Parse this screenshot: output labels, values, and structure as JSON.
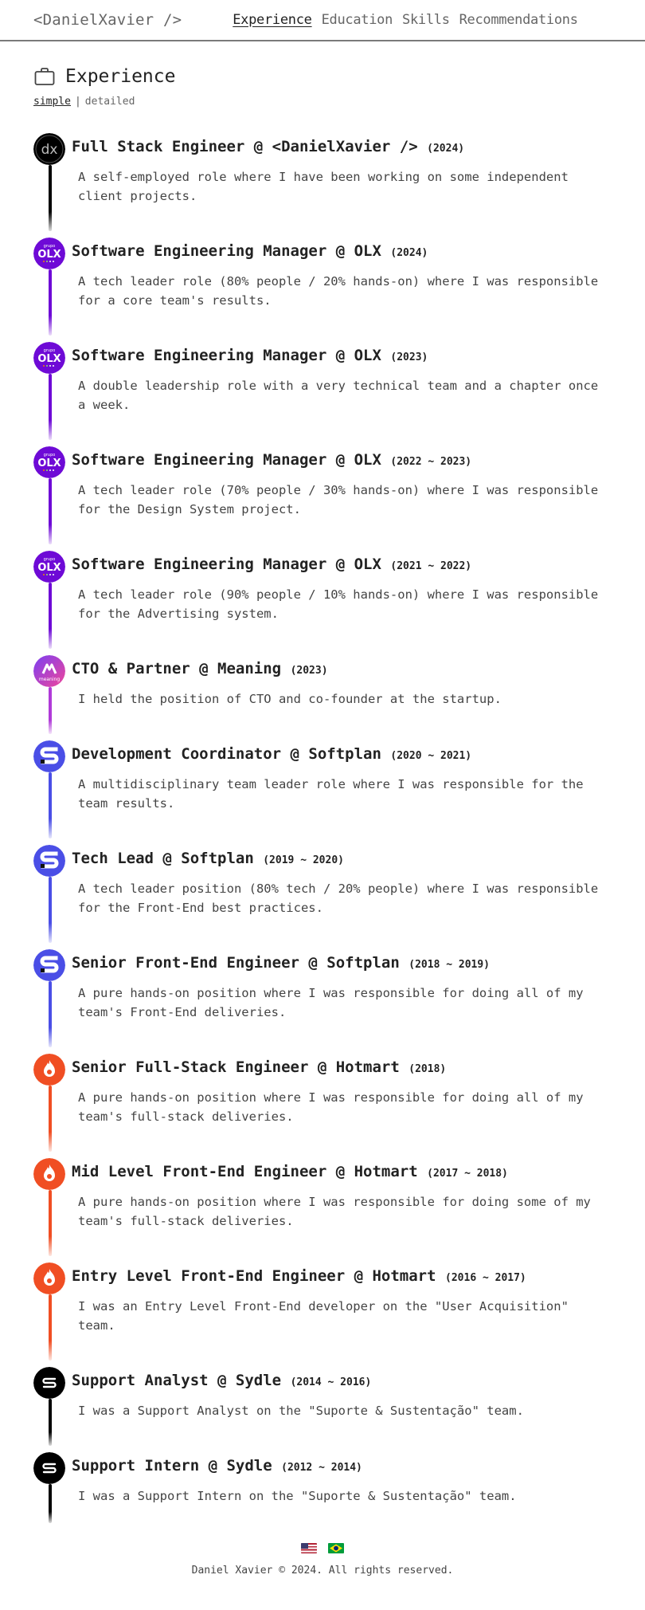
{
  "header": {
    "brand": "<DanielXavier />",
    "nav": [
      "Experience",
      "Education",
      "Skills",
      "Recommendations"
    ],
    "active_nav": "Experience"
  },
  "section": {
    "title": "Experience",
    "icon": "briefcase-icon",
    "modes": [
      "simple",
      "detailed"
    ],
    "active_mode": "simple"
  },
  "experiences": [
    {
      "role": "Full Stack Engineer @ <DanielXavier />",
      "period": "(2024)",
      "desc": "A self-employed role where I have been working on some independent client projects.",
      "logo": "dx",
      "color": "#000000"
    },
    {
      "role": "Software Engineering Manager @ OLX",
      "period": "(2024)",
      "desc": "A tech leader role (80% people / 20% hands-on) where I was responsible for a core team's results.",
      "logo": "olx",
      "color": "#6e0ad6"
    },
    {
      "role": "Software Engineering Manager @ OLX",
      "period": "(2023)",
      "desc": "A double leadership role with a very technical team and a chapter once a week.",
      "logo": "olx",
      "color": "#6e0ad6"
    },
    {
      "role": "Software Engineering Manager @ OLX",
      "period": "(2022 ~ 2023)",
      "desc": "A tech leader role (70% people / 30% hands-on) where I was responsible for the Design System project.",
      "logo": "olx",
      "color": "#6e0ad6"
    },
    {
      "role": "Software Engineering Manager @ OLX",
      "period": "(2021 ~ 2022)",
      "desc": "A tech leader role (90% people / 10% hands-on) where I was responsible for the Advertising system.",
      "logo": "olx",
      "color": "#6e0ad6"
    },
    {
      "role": "CTO & Partner @ Meaning",
      "period": "(2023)",
      "desc": "I held the position of CTO and co-founder at the startup.",
      "logo": "meaning",
      "color": "#b03ad8"
    },
    {
      "role": "Development Coordinator @ Softplan",
      "period": "(2020 ~ 2021)",
      "desc": "A multidisciplinary team leader role where I was responsible for the team results.",
      "logo": "softplan",
      "color": "#4a4ee6"
    },
    {
      "role": "Tech Lead @ Softplan",
      "period": "(2019 ~ 2020)",
      "desc": "A tech leader position (80% tech / 20% people) where I was responsible for the Front-End best practices.",
      "logo": "softplan",
      "color": "#4a4ee6"
    },
    {
      "role": "Senior Front-End Engineer @ Softplan",
      "period": "(2018 ~ 2019)",
      "desc": "A pure hands-on position where I was responsible for doing all of my team's Front-End deliveries.",
      "logo": "softplan",
      "color": "#4a4ee6"
    },
    {
      "role": "Senior Full-Stack Engineer @ Hotmart",
      "period": "(2018)",
      "desc": "A pure hands-on position where I was responsible for doing all of my team's full-stack deliveries.",
      "logo": "hotmart",
      "color": "#f04e23"
    },
    {
      "role": "Mid Level Front-End Engineer @ Hotmart",
      "period": "(2017 ~ 2018)",
      "desc": "A pure hands-on position where I was responsible for doing some of my team's full-stack deliveries.",
      "logo": "hotmart",
      "color": "#f04e23"
    },
    {
      "role": "Entry Level Front-End Engineer @ Hotmart",
      "period": "(2016 ~ 2017)",
      "desc": "I was an Entry Level Front-End developer on the \"User Acquisition\" team.",
      "logo": "hotmart",
      "color": "#f04e23"
    },
    {
      "role": "Support Analyst @ Sydle",
      "period": "(2014 ~ 2016)",
      "desc": "I was a Support Analyst on the \"Suporte & Sustentação\" team.",
      "logo": "sydle",
      "color": "#000000"
    },
    {
      "role": "Support Intern @ Sydle",
      "period": "(2012 ~ 2014)",
      "desc": "I was a Support Intern on the \"Suporte & Sustentação\" team.",
      "logo": "sydle",
      "color": "#000000"
    }
  ],
  "footer": {
    "flags": [
      "us-flag-icon",
      "br-flag-icon"
    ],
    "copyright": "Daniel Xavier © 2024. All rights reserved."
  }
}
